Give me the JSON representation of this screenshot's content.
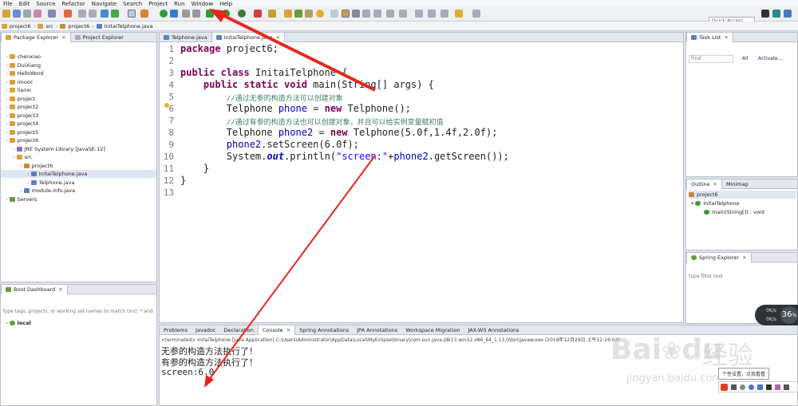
{
  "menu": [
    "File",
    "Edit",
    "Source",
    "Refactor",
    "Navigate",
    "Search",
    "Project",
    "Run",
    "Window",
    "Help"
  ],
  "toolbar": {
    "quick_access": "Quick Access"
  },
  "breadcrumb": [
    "project6",
    "src",
    "project6",
    "InitaiTelphone.java"
  ],
  "package_explorer": {
    "tabs": [
      "Package Explorer",
      "Project Explorer"
    ],
    "items": [
      {
        "label": "chenxiao",
        "depth": 0,
        "kind": "folder"
      },
      {
        "label": "DuiXiang",
        "depth": 0,
        "kind": "folder"
      },
      {
        "label": "HelloWord",
        "depth": 0,
        "kind": "folder"
      },
      {
        "label": "imooc",
        "depth": 0,
        "kind": "folder"
      },
      {
        "label": "lianxi",
        "depth": 0,
        "kind": "folder"
      },
      {
        "label": "project",
        "depth": 0,
        "kind": "folder"
      },
      {
        "label": "project2",
        "depth": 0,
        "kind": "folder"
      },
      {
        "label": "project3",
        "depth": 0,
        "kind": "folder"
      },
      {
        "label": "project4",
        "depth": 0,
        "kind": "folder"
      },
      {
        "label": "project5",
        "depth": 0,
        "kind": "folder"
      },
      {
        "label": "project6",
        "depth": 0,
        "kind": "folder"
      },
      {
        "label": "JRE System Library [JavaSE-12]",
        "depth": 1,
        "kind": "lib"
      },
      {
        "label": "src",
        "depth": 1,
        "kind": "folder"
      },
      {
        "label": "project6",
        "depth": 2,
        "kind": "pkg"
      },
      {
        "label": "InitaiTelphone.java",
        "depth": 3,
        "kind": "jfile",
        "selected": true
      },
      {
        "label": "Telphone.java",
        "depth": 3,
        "kind": "jfile"
      },
      {
        "label": "module-info.java",
        "depth": 2,
        "kind": "jfile"
      },
      {
        "label": "Servers",
        "depth": 0,
        "kind": "server"
      }
    ]
  },
  "boot_dashboard": {
    "title": "Boot Dashboard",
    "filter_placeholder": "Type tags, projects, or working set names to match (incl. * and",
    "item": "local"
  },
  "editor": {
    "tabs": [
      "Telphone.java",
      "InitaiTelphone.java"
    ],
    "line_numbers": [
      "1",
      "2",
      "3",
      "4",
      "5",
      "6",
      "7",
      "8",
      "9",
      "10",
      "11",
      "12",
      "13"
    ],
    "lines": {
      "l1_kw": "package",
      "l1_rest": " project6;",
      "l3_kw": "public class",
      "l3_rest": " InitaiTelphone {",
      "l4_kw": "public static void",
      "l4_rest": " main(String[] args) {",
      "l5_comment": "//通过无参的构造方法可以创建对象",
      "l6_a": "Telphone ",
      "l6_var": "phone",
      "l6_b": " = ",
      "l6_kw": "new",
      "l6_c": " Telphone();",
      "l7_comment": "//通过有参的构造方法也可以创建对象，并且可以给实例变量赋初值",
      "l8_a": "Telphone ",
      "l8_var": "phone2",
      "l8_b": " = ",
      "l8_kw": "new",
      "l8_c": " Telphone(5.0f,1.4f,2.0f);",
      "l9_var": "phone2",
      "l9_rest": ".setScreen(6.0f);",
      "l10_a": "System.",
      "l10_out": "out",
      "l10_b": ".println(",
      "l10_str": "\"screen:\"",
      "l10_c": "+",
      "l10_var": "phone2",
      "l10_d": ".getScreen());",
      "l11": "}",
      "l12": "}"
    }
  },
  "task_list": {
    "title": "Task List",
    "find_placeholder": "Find",
    "all": "All",
    "activate": "Activate..."
  },
  "outline": {
    "tabs": [
      "Outline",
      "Minimap"
    ],
    "items": [
      "project6",
      "InitaiTelphone",
      "main(String[]) : void"
    ]
  },
  "spring_explorer": {
    "title": "Spring Explorer",
    "filter_placeholder": "type filter text"
  },
  "bottom_tabs": [
    "Problems",
    "Javadoc",
    "Declaration",
    "Console",
    "Spring Annotations",
    "JPA Annotations",
    "Workspace Migration",
    "JAX-WS Annotations"
  ],
  "console": {
    "header": "<terminated> InitaiTelphone [Java Application] C:\\Users\\Administrator\\AppData\\Local\\MyEclipse\\binary\\com.sun.java.jdk13.win32.x86_64_1.13.0\\bin\\javaw.exe (2019年12月29日 上午12:26:04)",
    "lines": [
      "无参的构造方法执行了！",
      "有参的构造方法执行了！",
      "screen:6.0"
    ]
  },
  "overlay": {
    "watermark_main": "Bai",
    "watermark_du": "du",
    "watermark_cn": "经验",
    "watermark_url": "jingyan.baidu.com",
    "tooltip": "个性设置，点我看看",
    "speed_value": "36",
    "speed_unit": "%",
    "speed_up": "0K/s",
    "speed_down": "0K/s"
  },
  "colors": {
    "annotation_arrow": "#e8261b",
    "keyword": "#7f0055",
    "comment": "#3f7f5f"
  }
}
